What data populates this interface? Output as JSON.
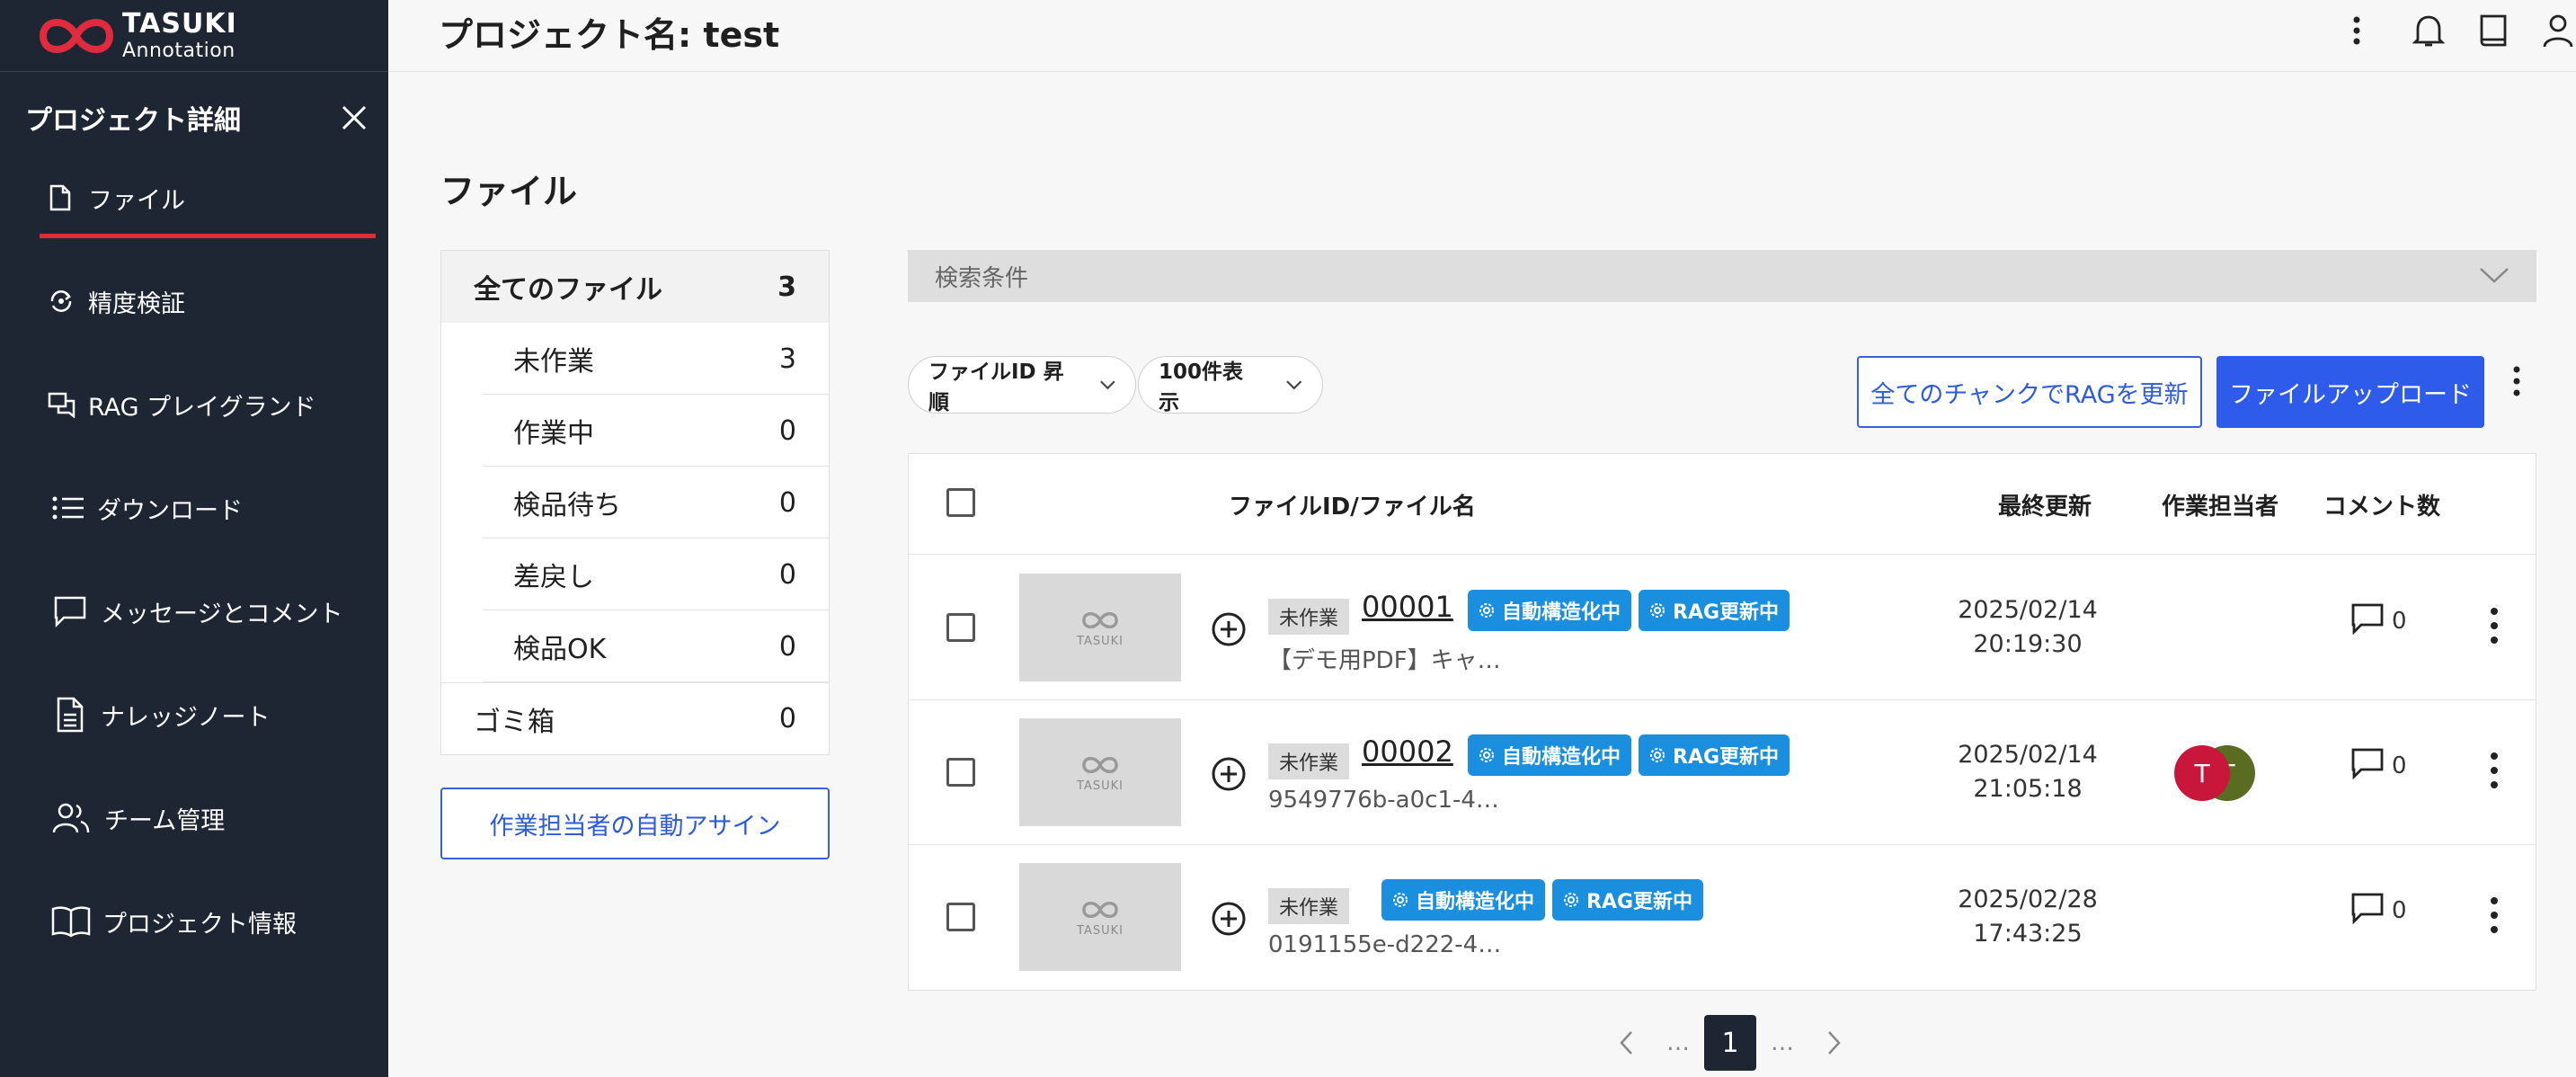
{
  "brand": {
    "line1": "TASUKI",
    "line2": "Annotation",
    "color": "#e02b3f"
  },
  "sidebar": {
    "title": "プロジェクト詳細",
    "items": [
      {
        "label": "ファイル",
        "icon": "file-icon"
      },
      {
        "label": "精度検証",
        "icon": "accuracy-icon"
      },
      {
        "label": "RAG プレイグランド",
        "icon": "chat-icon"
      },
      {
        "label": "ダウンロード",
        "icon": "list-icon"
      },
      {
        "label": "メッセージとコメント",
        "icon": "message-icon"
      },
      {
        "label": "ナレッジノート",
        "icon": "note-icon"
      },
      {
        "label": "チーム管理",
        "icon": "team-icon"
      },
      {
        "label": "プロジェクト情報",
        "icon": "book-icon"
      }
    ]
  },
  "header": {
    "title": "プロジェクト名: test"
  },
  "main": {
    "section_title": "ファイル",
    "filters": {
      "all": {
        "label": "全てのファイル",
        "count": "3"
      },
      "sub": [
        {
          "label": "未作業",
          "count": "3"
        },
        {
          "label": "作業中",
          "count": "0"
        },
        {
          "label": "検品待ち",
          "count": "0"
        },
        {
          "label": "差戻し",
          "count": "0"
        },
        {
          "label": "検品OK",
          "count": "0"
        }
      ],
      "trash": {
        "label": "ゴミ箱",
        "count": "0"
      }
    },
    "auto_assign_label": "作業担当者の自動アサイン",
    "search_label": "検索条件",
    "sort_select": "ファイルID 昇順",
    "page_size_select": "100件表示",
    "update_rag_label": "全てのチャンクでRAGを更新",
    "upload_label": "ファイルアップロード",
    "table": {
      "headers": {
        "file": "ファイルID/ファイル名",
        "updated": "最終更新",
        "assignee": "作業担当者",
        "comments": "コメント数"
      },
      "thumb_text": "TASUKI",
      "rows": [
        {
          "status": "未作業",
          "id": "00001",
          "chip1": "自動構造化中",
          "chip2": "RAG更新中",
          "name": "【デモ用PDF】キャ…",
          "date": "2025/02/14",
          "time": "20:19:30",
          "comments": "0",
          "avatars": []
        },
        {
          "status": "未作業",
          "id": "00002",
          "chip1": "自動構造化中",
          "chip2": "RAG更新中",
          "name": "9549776b-a0c1-4…",
          "date": "2025/02/14",
          "time": "21:05:18",
          "comments": "0",
          "avatars": [
            "T",
            "T"
          ]
        },
        {
          "status": "未作業",
          "id": "",
          "chip1": "自動構造化中",
          "chip2": "RAG更新中",
          "name": "0191155e-d222-4…",
          "date": "2025/02/28",
          "time": "17:43:25",
          "comments": "0",
          "avatars": []
        }
      ]
    },
    "pagination": {
      "ellipsis": "…",
      "current": "1"
    }
  }
}
